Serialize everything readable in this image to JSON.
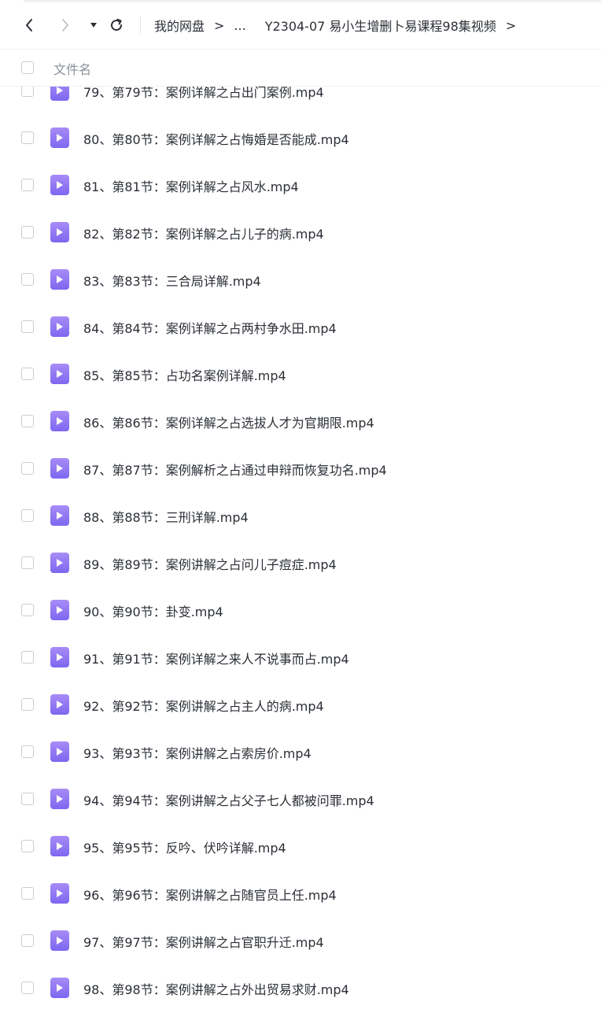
{
  "toolbar": {
    "back_icon": "chevron-left-icon",
    "forward_icon": "chevron-right-icon",
    "dropdown_icon": "caret-down-icon",
    "refresh_icon": "refresh-icon"
  },
  "breadcrumb": {
    "root": "我的网盘",
    "sep": ">",
    "ellipsis": "...",
    "current": "Y2304-07 易小生增删卜易课程98集视频",
    "trailing_sep": ">"
  },
  "list_header": {
    "name_label": "文件名"
  },
  "files": [
    {
      "name": "79、第79节：案例详解之占出门案例.mp4"
    },
    {
      "name": "80、第80节：案例详解之占悔婚是否能成.mp4"
    },
    {
      "name": "81、第81节：案例详解之占风水.mp4"
    },
    {
      "name": "82、第82节：案例详解之占儿子的病.mp4"
    },
    {
      "name": "83、第83节：三合局详解.mp4"
    },
    {
      "name": "84、第84节：案例详解之占两村争水田.mp4"
    },
    {
      "name": "85、第85节：占功名案例详解.mp4"
    },
    {
      "name": "86、第86节：案例详解之占选拔人才为官期限.mp4"
    },
    {
      "name": "87、第87节：案例解析之占通过申辩而恢复功名.mp4"
    },
    {
      "name": "88、第88节：三刑详解.mp4"
    },
    {
      "name": "89、第89节：案例讲解之占问儿子痘症.mp4"
    },
    {
      "name": "90、第90节：卦变.mp4"
    },
    {
      "name": "91、第91节：案例详解之来人不说事而占.mp4"
    },
    {
      "name": "92、第92节：案例讲解之占主人的病.mp4"
    },
    {
      "name": "93、第93节：案例讲解之占索房价.mp4"
    },
    {
      "name": "94、第94节：案例讲解之占父子七人都被问罪.mp4"
    },
    {
      "name": "95、第95节：反吟、伏吟详解.mp4"
    },
    {
      "name": "96、第96节：案例讲解之占随官员上任.mp4"
    },
    {
      "name": "97、第97节：案例讲解之占官职升迁.mp4"
    },
    {
      "name": "98、第98节：案例讲解之占外出贸易求财.mp4"
    }
  ],
  "colors": {
    "accent": "#7d67f0",
    "text": "#2b2f36",
    "muted": "#8a8f99"
  }
}
